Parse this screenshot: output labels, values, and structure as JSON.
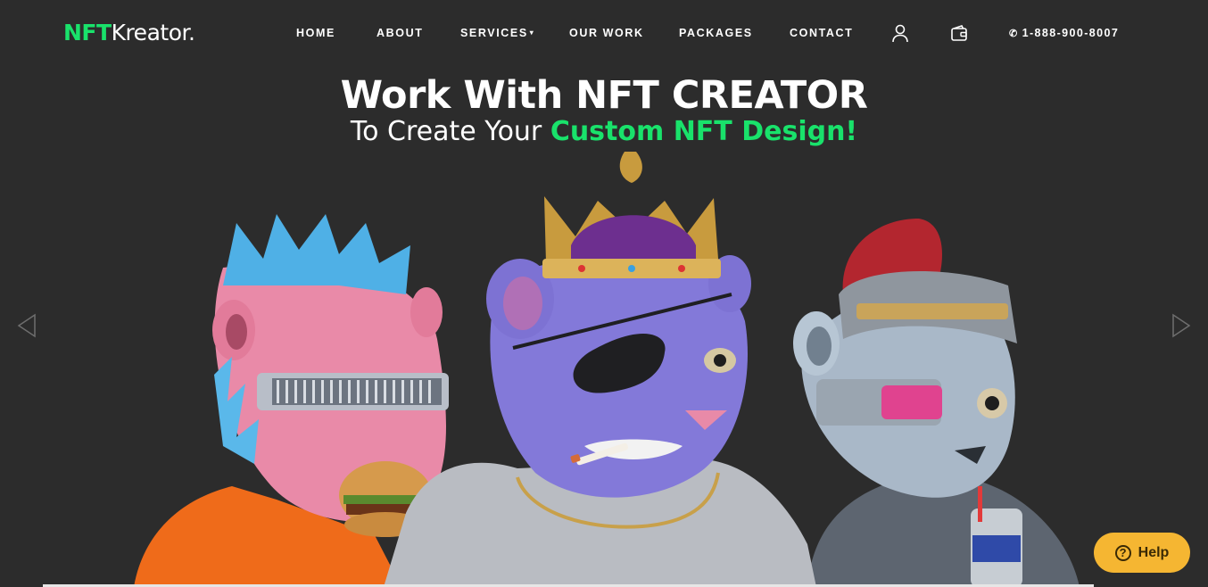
{
  "brand": {
    "logo_primary": "NFT",
    "logo_secondary": "Kreator",
    "logo_dot": ".",
    "accent_color": "#19e26b"
  },
  "nav": {
    "items": [
      {
        "label": "HOME"
      },
      {
        "label": "ABOUT"
      },
      {
        "label": "SERVICES",
        "has_dropdown": true,
        "caret": "▾"
      },
      {
        "label": "OUR WORK"
      },
      {
        "label": "PACKAGES"
      },
      {
        "label": "CONTACT"
      }
    ],
    "user_icon": "user-icon",
    "wallet_icon": "wallet-icon",
    "phone": {
      "icon": "phone-icon",
      "glyph": "✆",
      "number": "1-888-900-8007"
    }
  },
  "hero": {
    "title": "Work With NFT CREATOR",
    "subtitle_prefix": "To Create Your ",
    "subtitle_highlight": "Custom NFT Design!"
  },
  "slider": {
    "prev_icon": "chevron-left-icon",
    "next_icon": "chevron-right-icon"
  },
  "help": {
    "label": "Help",
    "icon": "question-circle-icon",
    "glyph": "?",
    "color": "#f5b632"
  }
}
